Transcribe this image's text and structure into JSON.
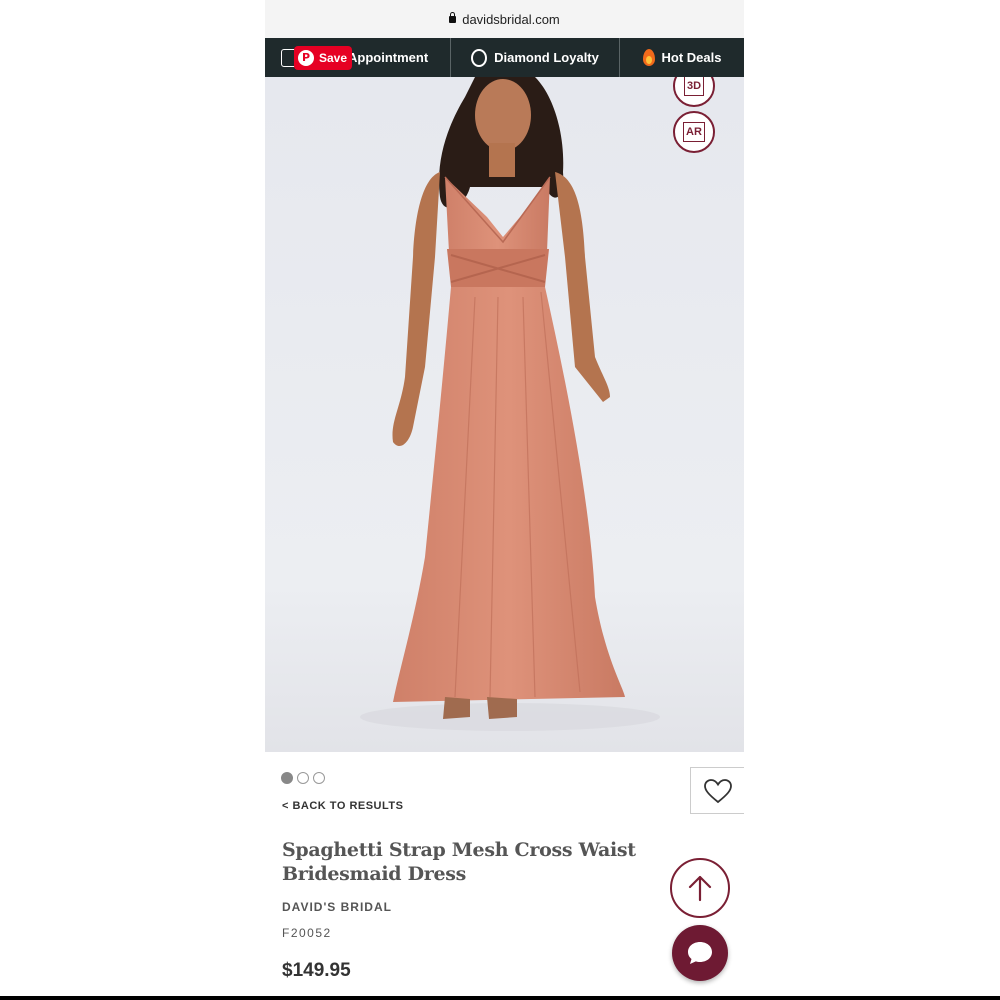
{
  "browser": {
    "url": "davidsbridal.com"
  },
  "nav": {
    "items": [
      {
        "label": "Appointment",
        "icon": "calendar-icon"
      },
      {
        "label": "Diamond Loyalty",
        "icon": "ring-icon"
      },
      {
        "label": "Hot Deals",
        "icon": "flame-icon"
      }
    ]
  },
  "pinterest": {
    "save_label": "Save"
  },
  "gallery": {
    "badges": [
      "3D",
      "AR"
    ],
    "dots": 3,
    "active_dot": 0
  },
  "product": {
    "back_label": "< BACK TO RESULTS",
    "title_line1": "Spaghetti Strap Mesh Cross Waist",
    "title_line2": "Bridesmaid Dress",
    "brand": "DAVID'S BRIDAL",
    "sku": "F20052",
    "price": "$149.95"
  },
  "colors": {
    "accent": "#7a1f34",
    "nav_bg": "#1f2a2c",
    "dress": "#d68a72",
    "pinterest": "#e60023"
  }
}
